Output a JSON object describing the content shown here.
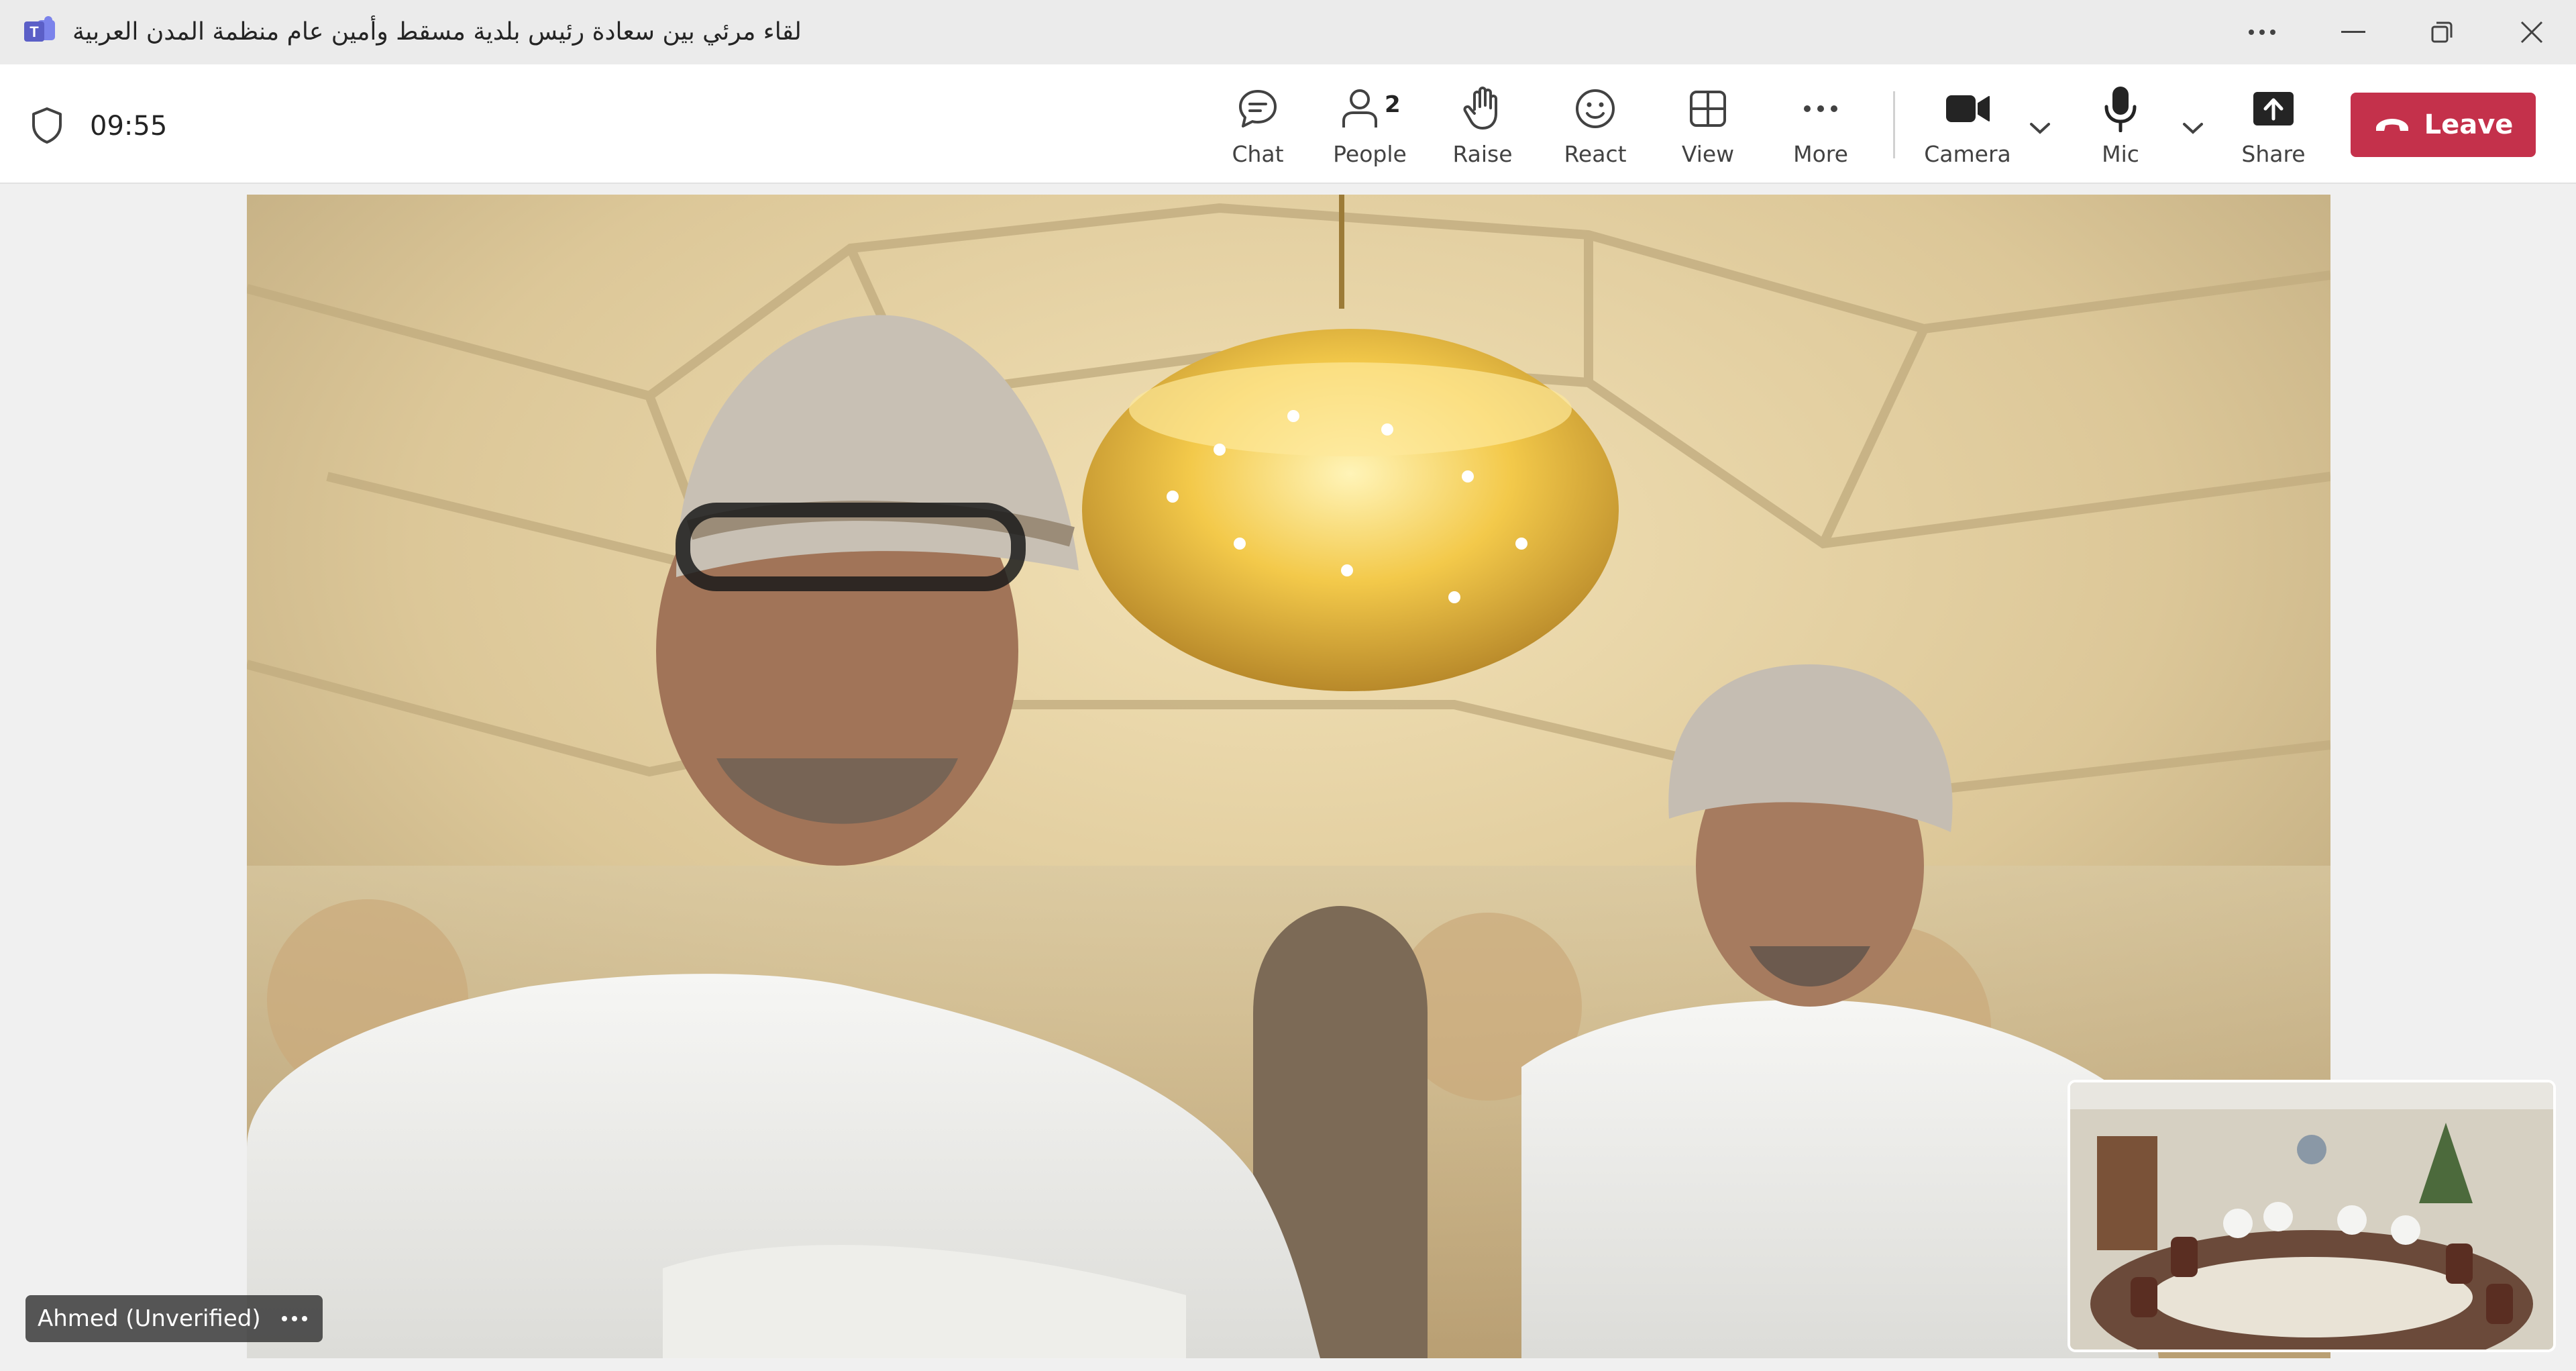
{
  "window": {
    "title": "لقاء مرئي بين سعادة رئيس بلدية مسقط وأمين عام منظمة المدن العربية",
    "app_icon": "teams-icon"
  },
  "toolbar": {
    "timer": "09:55",
    "items": [
      {
        "label": "Chat",
        "icon": "chat-icon"
      },
      {
        "label": "People",
        "icon": "people-icon",
        "count": "2"
      },
      {
        "label": "Raise",
        "icon": "raise-hand-icon"
      },
      {
        "label": "React",
        "icon": "react-icon"
      },
      {
        "label": "View",
        "icon": "view-grid-icon"
      },
      {
        "label": "More",
        "icon": "more-icon"
      },
      {
        "label": "Camera",
        "icon": "camera-icon"
      },
      {
        "label": "Mic",
        "icon": "mic-icon"
      },
      {
        "label": "Share",
        "icon": "share-icon"
      }
    ],
    "leave_label": "Leave"
  },
  "stage": {
    "participant_name": "Ahmed (Unverified)"
  },
  "colors": {
    "leave": "#c4314b",
    "teams_purple": "#5b5fc7"
  }
}
